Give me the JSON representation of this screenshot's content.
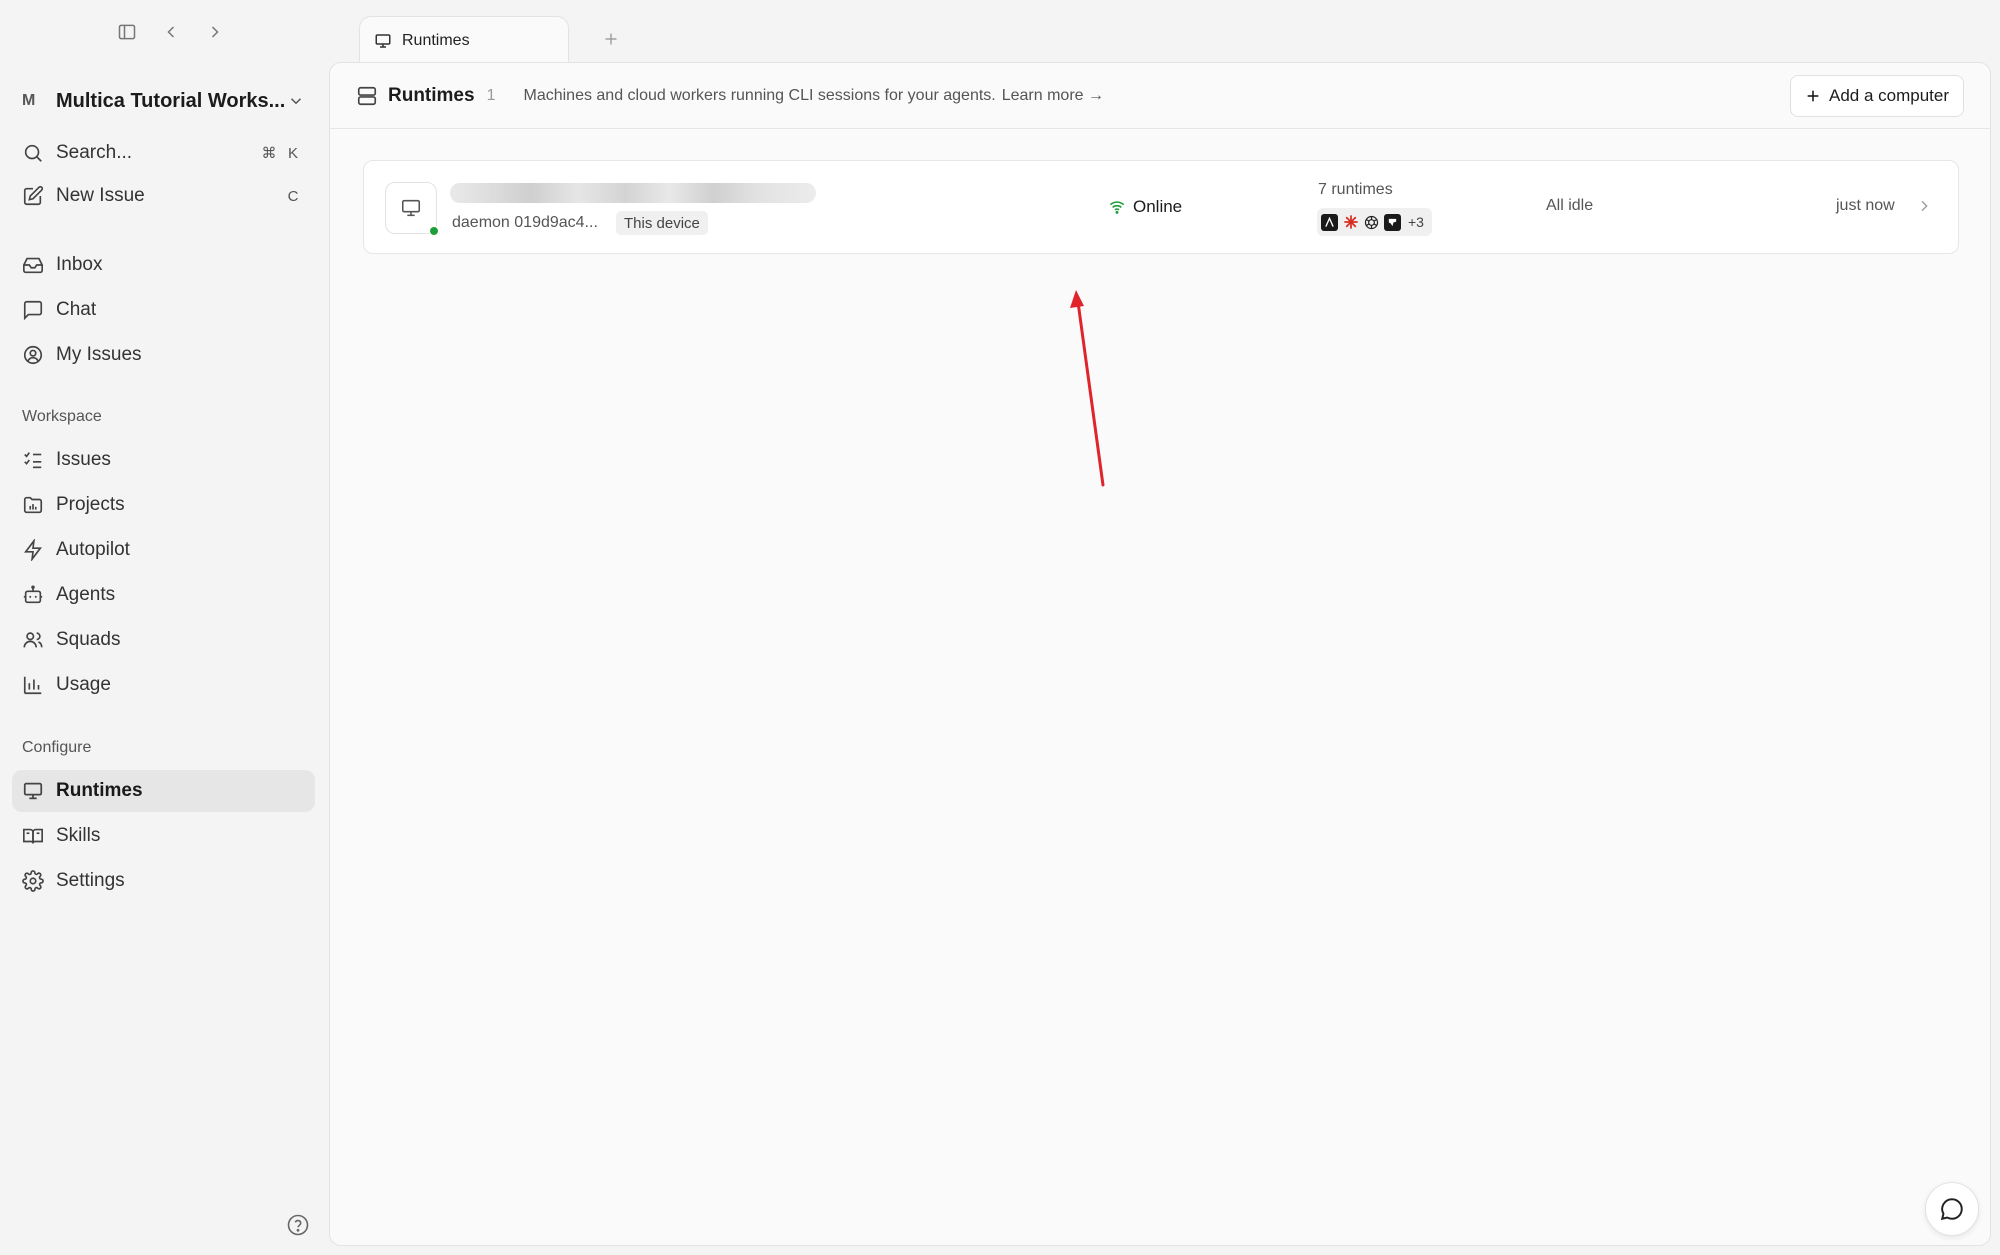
{
  "sidebar": {
    "workspace": {
      "avatar": "M",
      "name": "Multica Tutorial Works..."
    },
    "search": {
      "label": "Search...",
      "shortcut_mod": "⌘",
      "shortcut_key": "K"
    },
    "new_issue": {
      "label": "New Issue",
      "shortcut": "C"
    },
    "primary": [
      {
        "label": "Inbox",
        "icon": "inbox-icon"
      },
      {
        "label": "Chat",
        "icon": "chat-icon"
      },
      {
        "label": "My Issues",
        "icon": "user-circle-icon"
      }
    ],
    "workspace_section": {
      "label": "Workspace",
      "items": [
        {
          "label": "Issues",
          "icon": "list-checks-icon"
        },
        {
          "label": "Projects",
          "icon": "folder-icon"
        },
        {
          "label": "Autopilot",
          "icon": "zap-icon"
        },
        {
          "label": "Agents",
          "icon": "bot-icon"
        },
        {
          "label": "Squads",
          "icon": "users-icon"
        },
        {
          "label": "Usage",
          "icon": "bar-chart-icon"
        }
      ]
    },
    "configure_section": {
      "label": "Configure",
      "items": [
        {
          "label": "Runtimes",
          "icon": "monitor-icon",
          "active": true
        },
        {
          "label": "Skills",
          "icon": "book-icon"
        },
        {
          "label": "Settings",
          "icon": "gear-icon"
        }
      ]
    }
  },
  "tabs": [
    {
      "label": "Runtimes",
      "icon": "monitor-icon"
    }
  ],
  "header": {
    "title": "Runtimes",
    "count": "1",
    "description": "Machines and cloud workers running CLI sessions for your agents.",
    "link": "Learn more →",
    "add_button": "Add a computer"
  },
  "runtimes": [
    {
      "device_id": "daemon 019d9ac4...",
      "device_badge": "This device",
      "status": "Online",
      "runtime_count": "7 runtimes",
      "runtime_more": "+3",
      "activity": "All idle",
      "last_seen": "just now"
    }
  ],
  "colors": {
    "online": "#1f9d3a",
    "arrow": "#e0242b",
    "active_bg": "#e6e6e6"
  }
}
